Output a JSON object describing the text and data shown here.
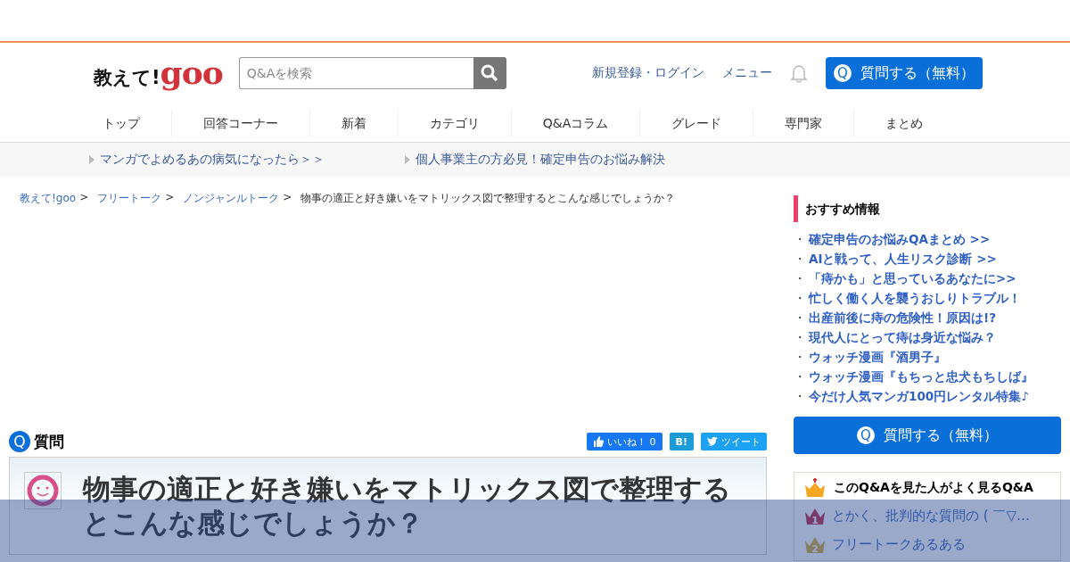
{
  "logo": {
    "prefix": "教えて!",
    "brand": "goo"
  },
  "search": {
    "placeholder": "Q&Aを検索"
  },
  "header_links": [
    "新規登録・ログイン",
    "メニュー"
  ],
  "ask_button": {
    "icon": "Q",
    "label": "質問する（無料）"
  },
  "nav": [
    "トップ",
    "回答コーナー",
    "新着",
    "カテゴリ",
    "Q&Aコラム",
    "グレード",
    "専門家",
    "まとめ"
  ],
  "promo_links": [
    "マンガでよめるあの病気になったら＞＞",
    "個人事業主の方必見！確定申告のお悩み解決"
  ],
  "breadcrumbs": [
    {
      "label": "教えて!goo",
      "link": true,
      "separator": ">"
    },
    {
      "label": "フリートーク",
      "link": true,
      "separator": ">"
    },
    {
      "label": "ノンジャンルトーク",
      "link": true,
      "separator": ">"
    },
    {
      "label": "物事の適正と好き嫌いをマトリックス図で整理するとこんな感じでしょうか？",
      "link": false
    }
  ],
  "question": {
    "badge": "Q",
    "heading": "質問",
    "title": "物事の適正と好き嫌いをマトリックス図で整理するとこんな感じでしょうか？"
  },
  "share": {
    "like_label": "いいね！",
    "like_count": "0",
    "hatena": "B!",
    "tweet": "ツイート"
  },
  "recommend": {
    "title": "おすすめ情報",
    "items": [
      {
        "bullet": "・",
        "label": "確定申告のお悩みQAまとめ >>"
      },
      {
        "bullet": "・",
        "label": "AIと戦って、人生リスク診断 >>"
      },
      {
        "bullet": "・",
        "label": "「痔かも」と思っているあなたに>>"
      },
      {
        "bullet": "・",
        "label": "忙しく働く人を襲うおしりトラブル！"
      },
      {
        "bullet": "・",
        "label": "出産前後に痔の危険性！原因は!?"
      },
      {
        "bullet": "・",
        "label": "現代人にとって痔は身近な悩み？"
      },
      {
        "bullet": "・",
        "label": "ウォッチ漫画『酒男子』"
      },
      {
        "bullet": "・",
        "label": "ウォッチ漫画『もちっと忠犬もちしば』"
      },
      {
        "bullet": "・",
        "label": "今だけ人気マンガ100円レンタル特集♪"
      }
    ]
  },
  "side_ask_button": {
    "icon": "Q",
    "label": "質問する（無料）"
  },
  "popular": {
    "title": "このQ&Aを見た人がよく見るQ&A",
    "items": [
      {
        "rank": "1",
        "label": "とかく、批判的な質問の ( ￣▽…"
      },
      {
        "rank": "2",
        "label": "フリートークあるある"
      }
    ]
  }
}
